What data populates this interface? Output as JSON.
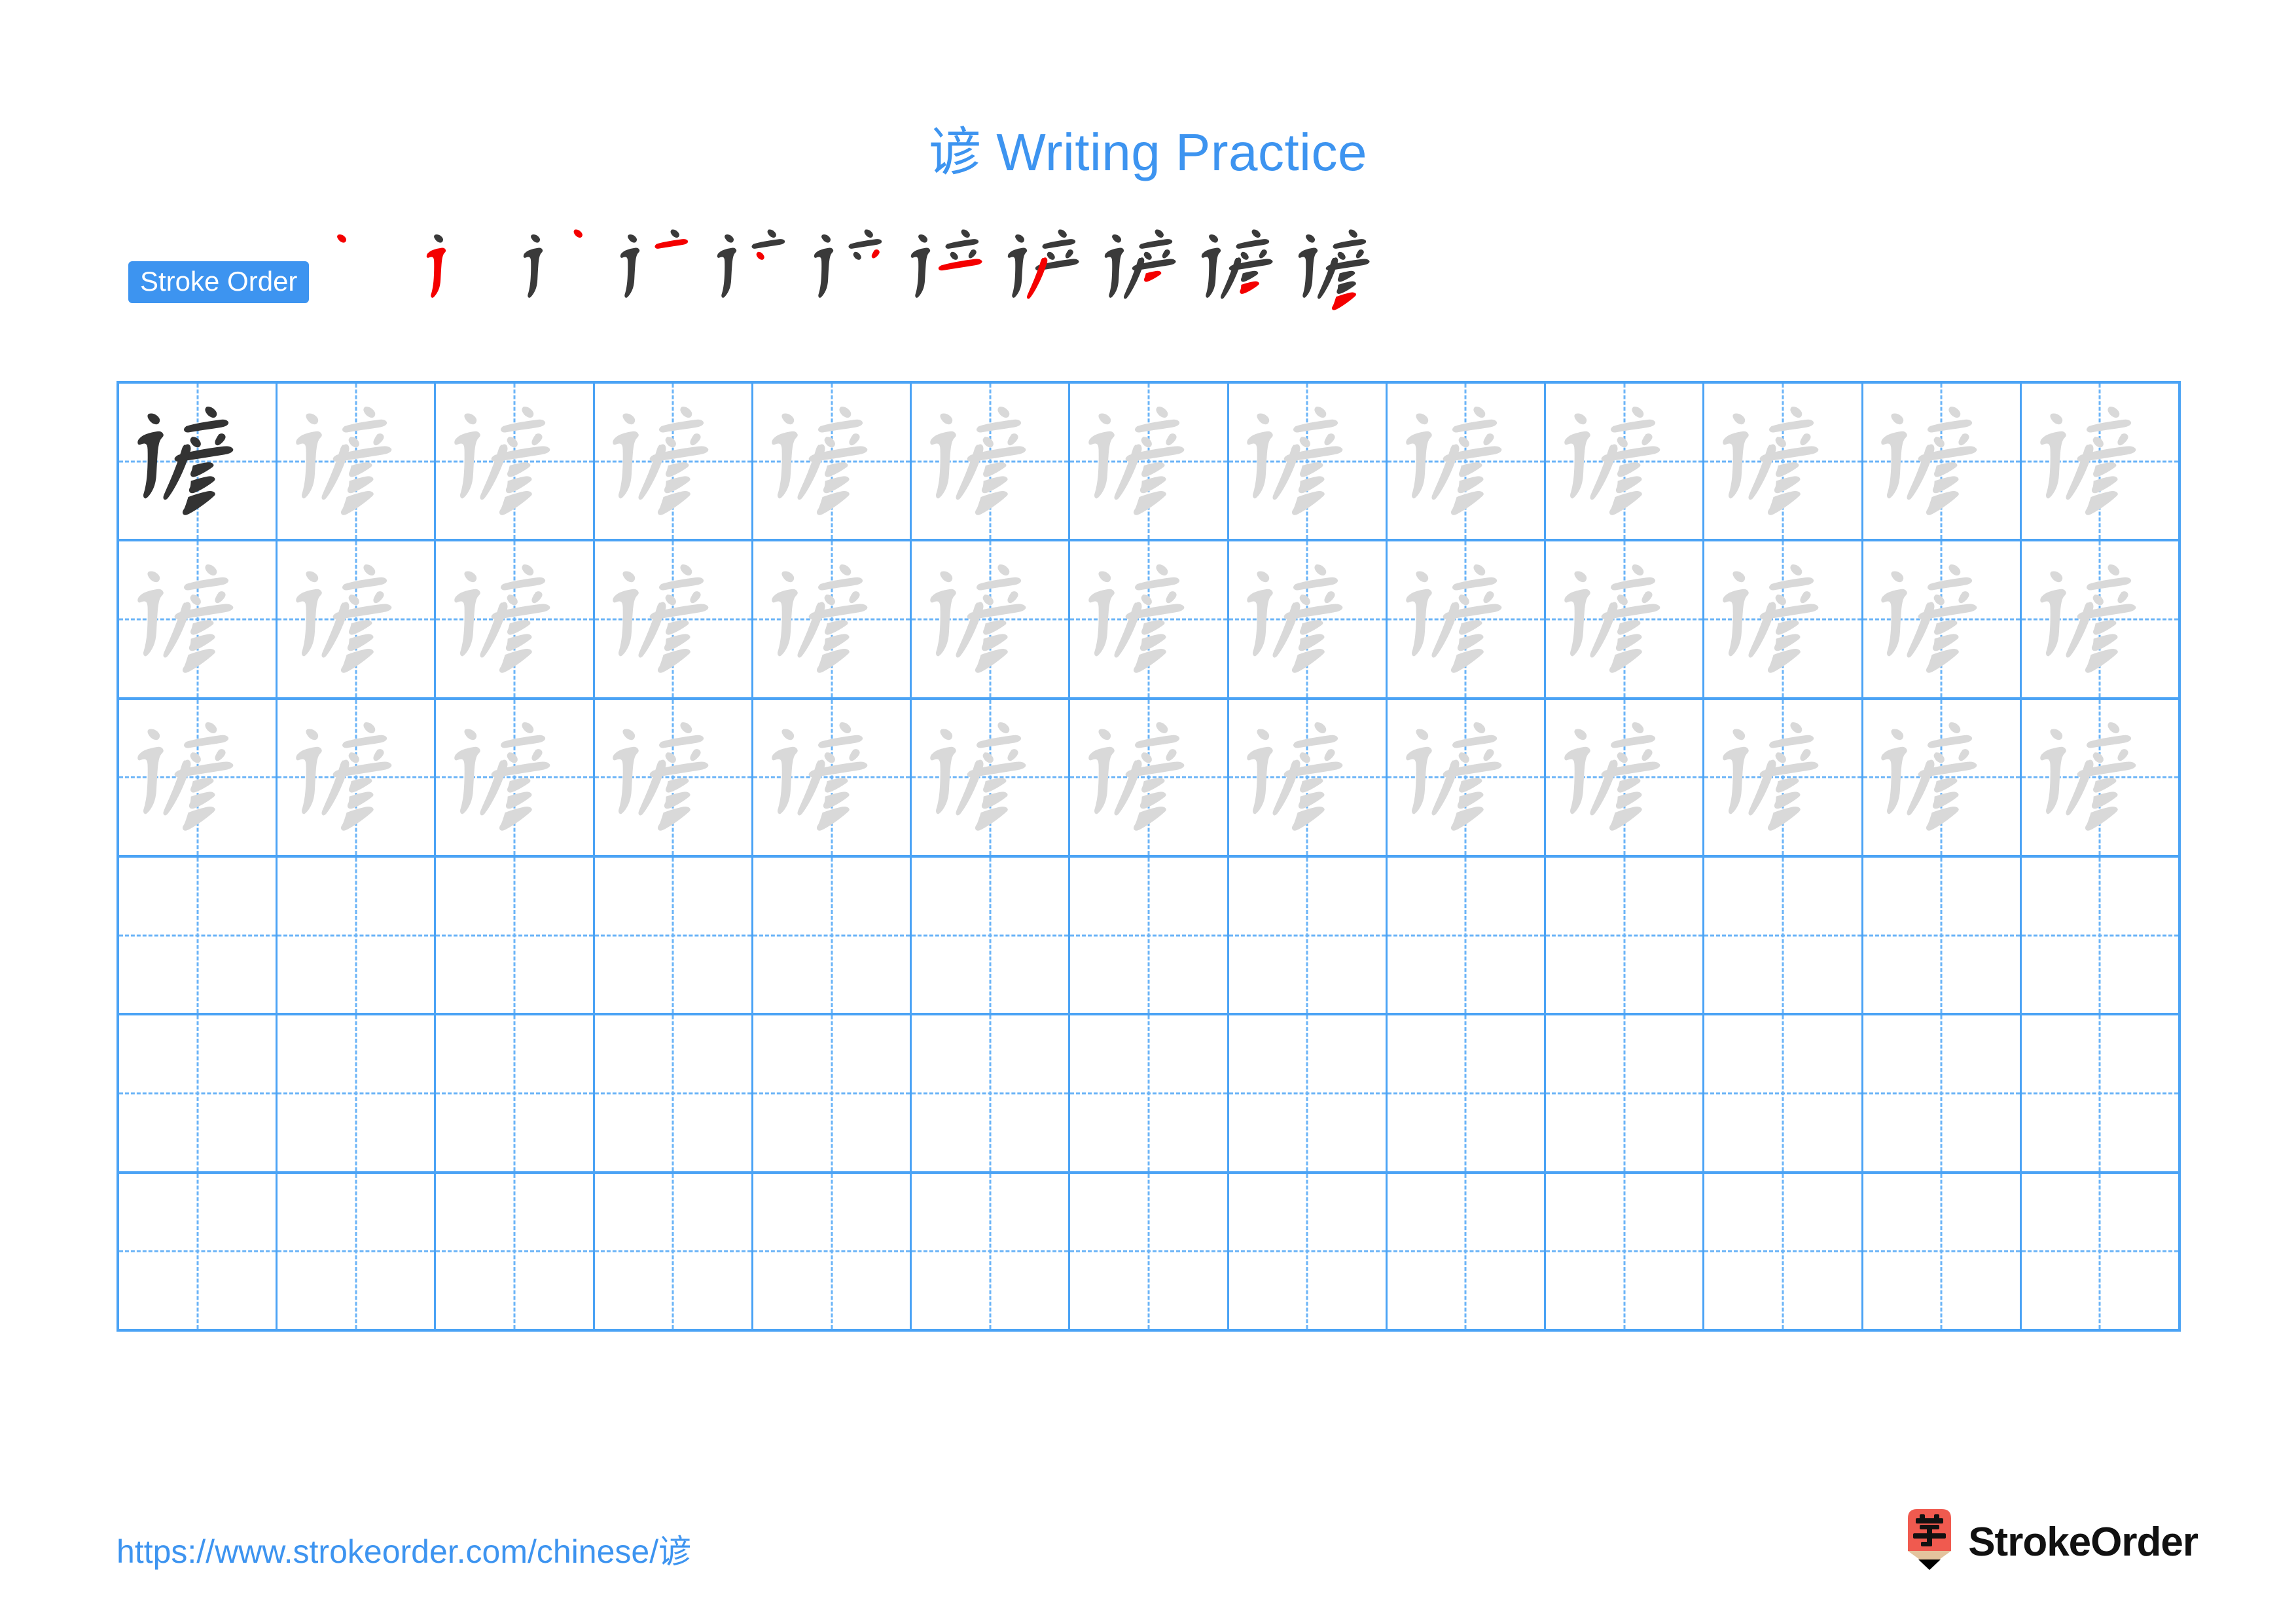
{
  "page": {
    "character": "谚",
    "title": "谚 Writing Practice",
    "background_color": "#ffffff"
  },
  "colors": {
    "accent_blue": "#3d94f0",
    "grid_blue": "#4ba3f5",
    "grid_dash_blue": "#6bb4f7",
    "stroke_new_red": "#f40000",
    "stroke_prev_dark": "#3a3a3a",
    "model_char_dark": "#333333",
    "trace_char_gray": "#d9d9d9",
    "logo_red": "#f05a4f",
    "logo_wood": "#e3c39d"
  },
  "stroke_order": {
    "badge_label": "Stroke Order",
    "total_strokes": 11,
    "steps": [
      {
        "index": 1,
        "new_stroke_name": "dian",
        "char_partial": "丶"
      },
      {
        "index": 2,
        "new_stroke_name": "hengzhezhe",
        "char_partial": "讠"
      },
      {
        "index": 3,
        "new_stroke_name": "dian",
        "char_partial": "讠丶"
      },
      {
        "index": 4,
        "new_stroke_name": "heng",
        "char_partial": "讠亠"
      },
      {
        "index": 5,
        "new_stroke_name": "dian",
        "char_partial": "讠亠丶"
      },
      {
        "index": 6,
        "new_stroke_name": "pie",
        "char_partial": "讠立上"
      },
      {
        "index": 7,
        "new_stroke_name": "heng",
        "char_partial": "讠立"
      },
      {
        "index": 8,
        "new_stroke_name": "pie",
        "char_partial": "讠产"
      },
      {
        "index": 9,
        "new_stroke_name": "pie",
        "char_partial": "讠彦一"
      },
      {
        "index": 10,
        "new_stroke_name": "pie",
        "char_partial": "讠彦二"
      },
      {
        "index": 11,
        "new_stroke_name": "pie",
        "char_partial": "谚"
      }
    ]
  },
  "grid": {
    "columns": 13,
    "rows": 6,
    "rows_data": [
      {
        "row": 1,
        "cells": [
          "dark",
          "light",
          "light",
          "light",
          "light",
          "light",
          "light",
          "light",
          "light",
          "light",
          "light",
          "light",
          "light"
        ]
      },
      {
        "row": 2,
        "cells": [
          "light",
          "light",
          "light",
          "light",
          "light",
          "light",
          "light",
          "light",
          "light",
          "light",
          "light",
          "light",
          "light"
        ]
      },
      {
        "row": 3,
        "cells": [
          "light",
          "light",
          "light",
          "light",
          "light",
          "light",
          "light",
          "light",
          "light",
          "light",
          "light",
          "light",
          "light"
        ]
      },
      {
        "row": 4,
        "cells": [
          "empty",
          "empty",
          "empty",
          "empty",
          "empty",
          "empty",
          "empty",
          "empty",
          "empty",
          "empty",
          "empty",
          "empty",
          "empty"
        ]
      },
      {
        "row": 5,
        "cells": [
          "empty",
          "empty",
          "empty",
          "empty",
          "empty",
          "empty",
          "empty",
          "empty",
          "empty",
          "empty",
          "empty",
          "empty",
          "empty"
        ]
      },
      {
        "row": 6,
        "cells": [
          "empty",
          "empty",
          "empty",
          "empty",
          "empty",
          "empty",
          "empty",
          "empty",
          "empty",
          "empty",
          "empty",
          "empty",
          "empty"
        ]
      }
    ]
  },
  "footer": {
    "url_text": "https://www.strokeorder.com/chinese/谚",
    "brand_name": "StrokeOrder",
    "brand_icon_char": "字"
  }
}
